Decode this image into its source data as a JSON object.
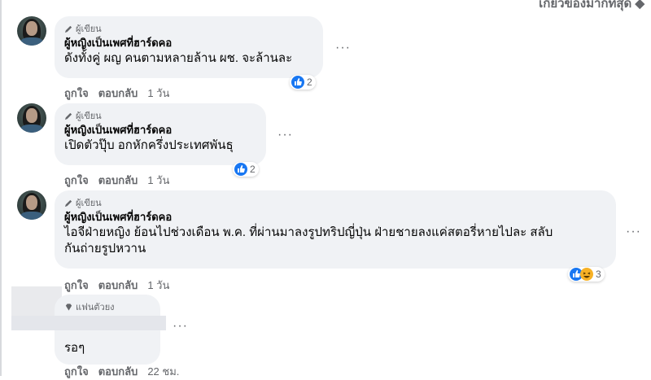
{
  "header": {
    "sort_label": "เกี่ยวข้องมากที่สุด ◆"
  },
  "comments": [
    {
      "badge": "ผู้เขียน",
      "author": "ผู้หญิงเป็นเพศที่ฮาร์ดคอ",
      "lines": [
        "ดังทั้งคู่ ผญ คนตามหลายล้าน ผช. จะล้านละ"
      ],
      "like_label": "ถูกใจ",
      "reply_label": "ตอบกลับ",
      "time": "1 วัน",
      "reactions": [
        "like-icon"
      ],
      "reaction_count": "2",
      "more": "···"
    },
    {
      "badge": "ผู้เขียน",
      "author": "ผู้หญิงเป็นเพศที่ฮาร์ดคอ",
      "lines": [
        "เปิดตัวปุ๊บ อกหักครึ่งประเทศพันธุ"
      ],
      "like_label": "ถูกใจ",
      "reply_label": "ตอบกลับ",
      "time": "1 วัน",
      "reactions": [
        "like-icon"
      ],
      "reaction_count": "2",
      "more": "···"
    },
    {
      "badge": "ผู้เขียน",
      "author": "ผู้หญิงเป็นเพศที่ฮาร์ดคอ",
      "lines": [
        "ไอจีฝ่ายหญิง ย้อนไปช่วงเดือน พ.ค. ที่ผ่านมาลงรูปทริปญี่ปุ่น ฝ่ายชายลงแค่สตอรี่หายไปละ สลับ",
        "กันถ่ายรูปหวาน"
      ],
      "like_label": "ถูกใจ",
      "reply_label": "ตอบกลับ",
      "time": "1 วัน",
      "reactions": [
        "like-icon",
        "haha-icon"
      ],
      "reaction_count": "3",
      "more": "···"
    },
    {
      "badge": "แฟนตัวยง",
      "author": "",
      "lines": [
        "รอๆ"
      ],
      "like_label": "ถูกใจ",
      "reply_label": "ตอบกลับ",
      "time": "22 ชม.",
      "more": "···"
    }
  ],
  "colors": {
    "like_blue": "#1877f2",
    "bubble_bg": "#f0f2f5",
    "muted": "#65676b"
  }
}
